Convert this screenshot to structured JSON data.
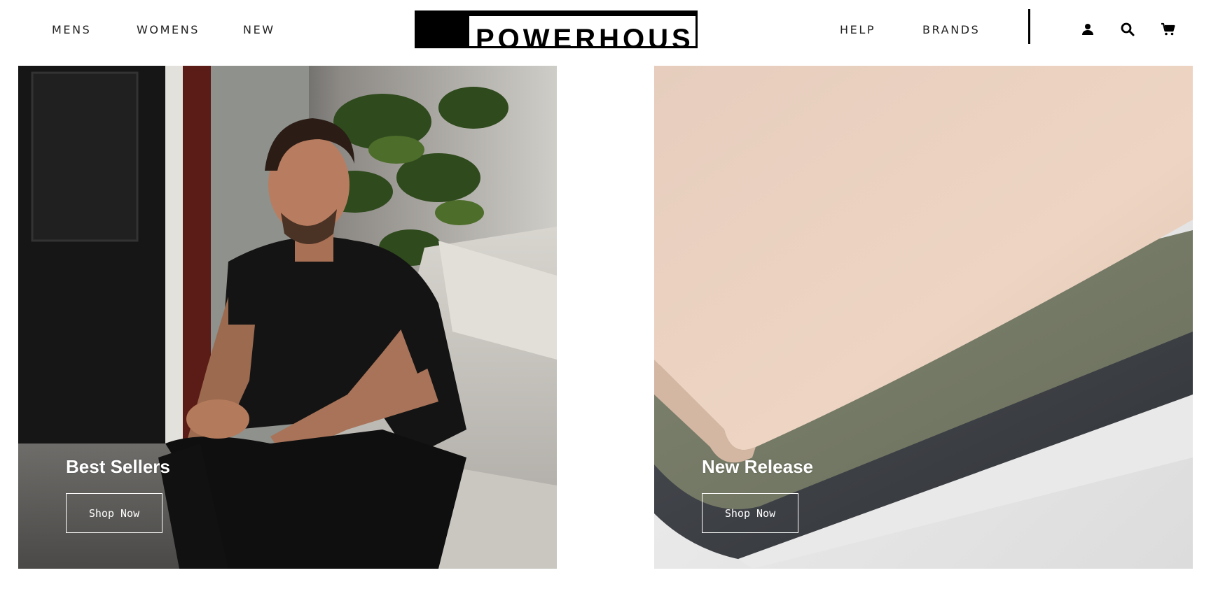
{
  "header": {
    "nav_left": [
      "MENS",
      "WOMENS",
      "NEW"
    ],
    "nav_right": [
      "HELP",
      "BRANDS"
    ],
    "logo_icon": "brand-logo",
    "icons": [
      "account-icon",
      "search-icon",
      "cart-icon"
    ]
  },
  "tiles": [
    {
      "title": "Best Sellers",
      "button_label": "Shop Now",
      "image": "man-in-black-tshirt-on-sofa"
    },
    {
      "title": "New Release",
      "button_label": "Shop Now",
      "image": "folded-tshirts-beige-olive-charcoal"
    }
  ],
  "colors": {
    "background": "#ffffff",
    "text": "#222222",
    "overlay_text": "#ffffff"
  }
}
